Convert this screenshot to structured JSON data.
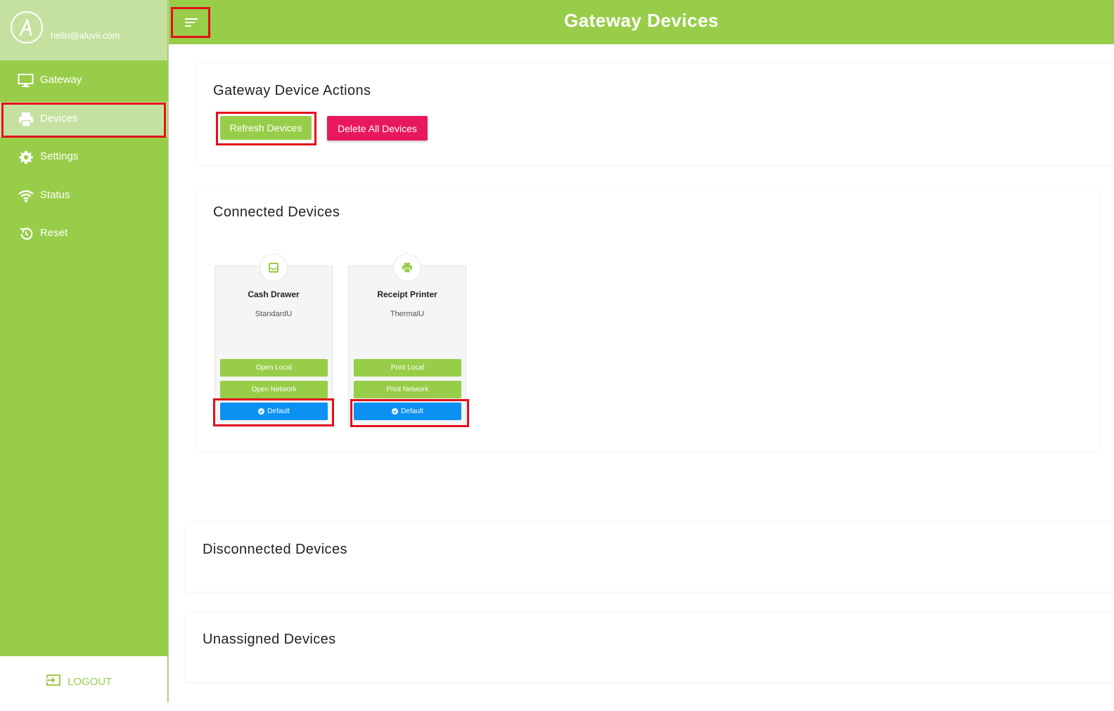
{
  "sidebar": {
    "logo_letter": "A",
    "email": "hello@aluvii.com",
    "items": [
      {
        "label": "Gateway",
        "icon": "monitor-icon"
      },
      {
        "label": "Devices",
        "icon": "printer-icon"
      },
      {
        "label": "Settings",
        "icon": "gear-icon"
      },
      {
        "label": "Status",
        "icon": "wifi-icon"
      },
      {
        "label": "Reset",
        "icon": "reset-icon"
      }
    ],
    "active_item": "Devices",
    "logout_label": "LOGOUT"
  },
  "header": {
    "title": "Gateway Devices",
    "menu_icon": "menu-icon"
  },
  "actions": {
    "title": "Gateway Device Actions",
    "refresh_label": "Refresh Devices",
    "delete_label": "Delete All Devices"
  },
  "connected": {
    "title": "Connected Devices",
    "devices": [
      {
        "name": "Cash Drawer",
        "model": "StandardU",
        "icon": "inbox-icon",
        "buttons": [
          "Open Local",
          "Open Network"
        ],
        "default_label": "Default"
      },
      {
        "name": "Receipt Printer",
        "model": "ThermalU",
        "icon": "printer-icon",
        "buttons": [
          "Print Local",
          "Print Network"
        ],
        "default_label": "Default"
      }
    ]
  },
  "disconnected": {
    "title": "Disconnected Devices"
  },
  "unassigned": {
    "title": "Unassigned Devices"
  },
  "colors": {
    "brand_green": "#98cd49",
    "light_green": "#c5e1a0",
    "danger_pink": "#e8185e",
    "default_blue": "#0c91f3",
    "highlight_red": "#e30f1b"
  }
}
